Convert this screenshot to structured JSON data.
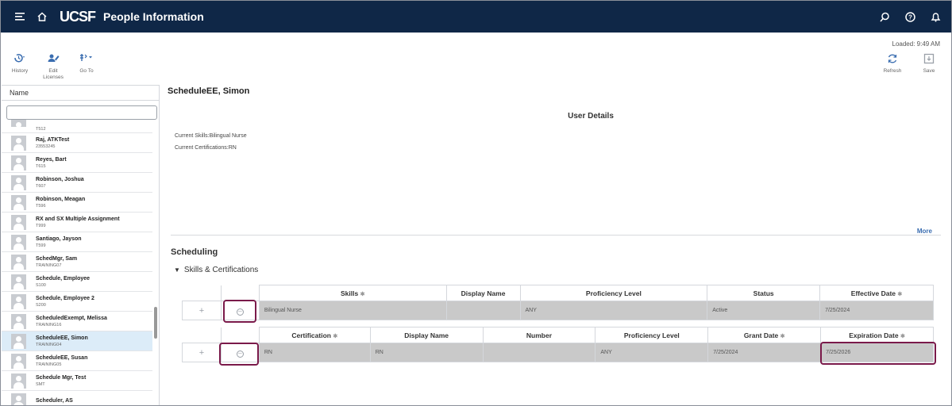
{
  "topbar": {
    "logo": "UCSF",
    "title": "People Information"
  },
  "toolbar": {
    "loaded": "Loaded: 9:49 AM",
    "history": "History",
    "edit_licenses": "Edit Licenses",
    "goto": "Go To",
    "refresh": "Refresh",
    "save": "Save"
  },
  "left_panel": {
    "header": "Name",
    "search_value": "",
    "people": [
      {
        "name": "",
        "id": "T512",
        "partial": true
      },
      {
        "name": "Raj, ATKTest",
        "id": "23553245"
      },
      {
        "name": "Reyes, Bart",
        "id": "T615"
      },
      {
        "name": "Robinson, Joshua",
        "id": "T607"
      },
      {
        "name": "Robinson, Meagan",
        "id": "T596"
      },
      {
        "name": "RX and SX Multiple Assignment",
        "id": "T999"
      },
      {
        "name": "Santiago, Jayson",
        "id": "T599"
      },
      {
        "name": "SchedMgr, Sam",
        "id": "TRAINING07"
      },
      {
        "name": "Schedule, Employee",
        "id": "S100"
      },
      {
        "name": "Schedule, Employee 2",
        "id": "S200"
      },
      {
        "name": "ScheduledExempt, Melissa",
        "id": "TRAINING16"
      },
      {
        "name": "ScheduleEE, Simon",
        "id": "TRAINING04",
        "selected": true
      },
      {
        "name": "ScheduleEE, Susan",
        "id": "TRAINING05"
      },
      {
        "name": "Schedule Mgr, Test",
        "id": "SMT"
      },
      {
        "name": "Scheduler, AS",
        "id": ""
      }
    ]
  },
  "main": {
    "employee_name": "ScheduleEE, Simon",
    "user_details_title": "User Details",
    "current_skills": "Current Skills:Bilingual Nurse",
    "current_certifications": "Current Certifications:RN",
    "more": "More",
    "scheduling_title": "Scheduling",
    "skills_section": "Skills & Certifications"
  },
  "skills_table": {
    "headers": [
      "Skills",
      "Display Name",
      "Proficiency Level",
      "Status",
      "Effective Date"
    ],
    "required": [
      true,
      false,
      false,
      false,
      true
    ],
    "row": [
      "Bilingual Nurse",
      "",
      "ANY",
      "Active",
      "7/25/2024"
    ]
  },
  "cert_table": {
    "headers": [
      "Certification",
      "Display Name",
      "Number",
      "Proficiency Level",
      "Grant Date",
      "Expiration Date"
    ],
    "required": [
      true,
      false,
      false,
      false,
      true,
      true
    ],
    "row": [
      "RN",
      "RN",
      "",
      "ANY",
      "7/25/2024",
      "7/25/2026"
    ]
  },
  "icons": {
    "menu": "menu-icon",
    "home": "home-icon",
    "search": "search-icon",
    "help": "help-icon",
    "notifications": "bell-icon",
    "history": "history-icon",
    "edit_licenses": "edit-licenses-icon",
    "goto": "goto-icon",
    "refresh": "refresh-icon",
    "save": "save-icon",
    "add": "plus-icon",
    "remove": "minus-circle-icon"
  },
  "colors": {
    "topbar": "#0f2747",
    "highlight": "#7a1a4a",
    "selected_row": "#dcecf8",
    "link": "#3a6db0"
  }
}
